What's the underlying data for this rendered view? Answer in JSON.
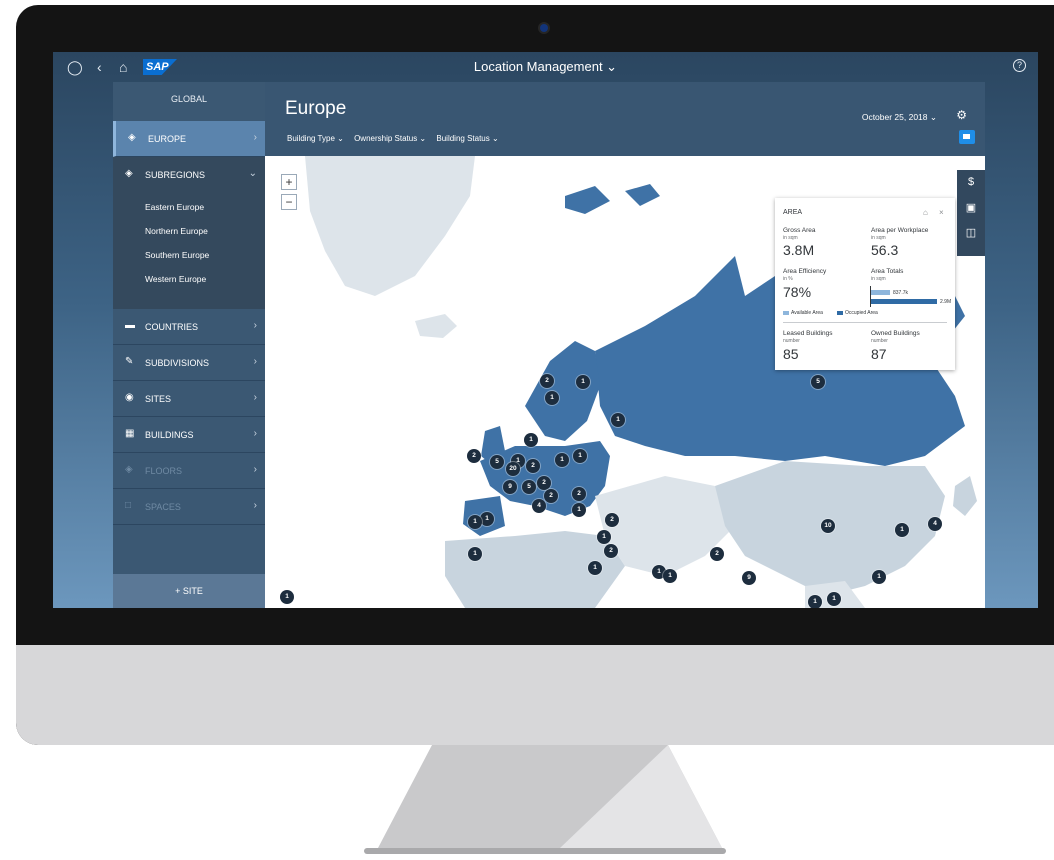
{
  "shell": {
    "app_title": "Location Management ⌄"
  },
  "sidebar": {
    "global": "GLOBAL",
    "europe": "EUROPE",
    "subregions": "SUBREGIONS",
    "subregion_links": [
      "Eastern Europe",
      "Northern Europe",
      "Southern Europe",
      "Western Europe"
    ],
    "countries": "COUNTRIES",
    "subdivisions": "SUBDIVISIONS",
    "sites": "SITES",
    "buildings": "BUILDINGS",
    "floors": "FLOORS",
    "spaces": "SPACES",
    "add_site": "+ SITE"
  },
  "header": {
    "title": "Europe",
    "date": "October 25, 2018",
    "filters": [
      "Building Type",
      "Ownership Status",
      "Building Status"
    ]
  },
  "map": {
    "zoom_in": "+",
    "zoom_out": "−",
    "pins": [
      "2",
      "1",
      "1",
      "1",
      "1",
      "1",
      "2",
      "5",
      "1",
      "20",
      "2",
      "1",
      "9",
      "5",
      "2",
      "2",
      "4",
      "2",
      "1",
      "1",
      "1",
      "2",
      "1",
      "2",
      "1",
      "1",
      "1",
      "1",
      "5",
      "10",
      "1",
      "4",
      "2",
      "9",
      "1",
      "1",
      "1",
      "1"
    ]
  },
  "area_card": {
    "title": "AREA",
    "gross_area": {
      "label": "Gross Area",
      "unit": "in sqm",
      "value": "3.8M"
    },
    "area_per_workplace": {
      "label": "Area per Workplace",
      "unit": "in sqm",
      "value": "56.3"
    },
    "area_efficiency": {
      "label": "Area Efficiency",
      "unit": "in %",
      "value": "78%"
    },
    "area_totals": {
      "label": "Area Totals",
      "unit": "in sqm",
      "available_value": "837.7k",
      "occupied_value": "2.9M",
      "available_fraction": 0.29,
      "occupied_fraction": 1.0
    },
    "legend_available": "Available Area",
    "legend_occupied": "Occupied Area",
    "leased_buildings": {
      "label": "Leased Buildings",
      "unit": "number",
      "value": "85"
    },
    "owned_buildings": {
      "label": "Owned Buildings",
      "unit": "number",
      "value": "87"
    }
  },
  "colors": {
    "map_highlight": "#3f72a6",
    "map_country": "#c8d4de",
    "map_land": "#dde4ea",
    "pin": "#1d2d3e",
    "accent": "#1f8ee8"
  }
}
